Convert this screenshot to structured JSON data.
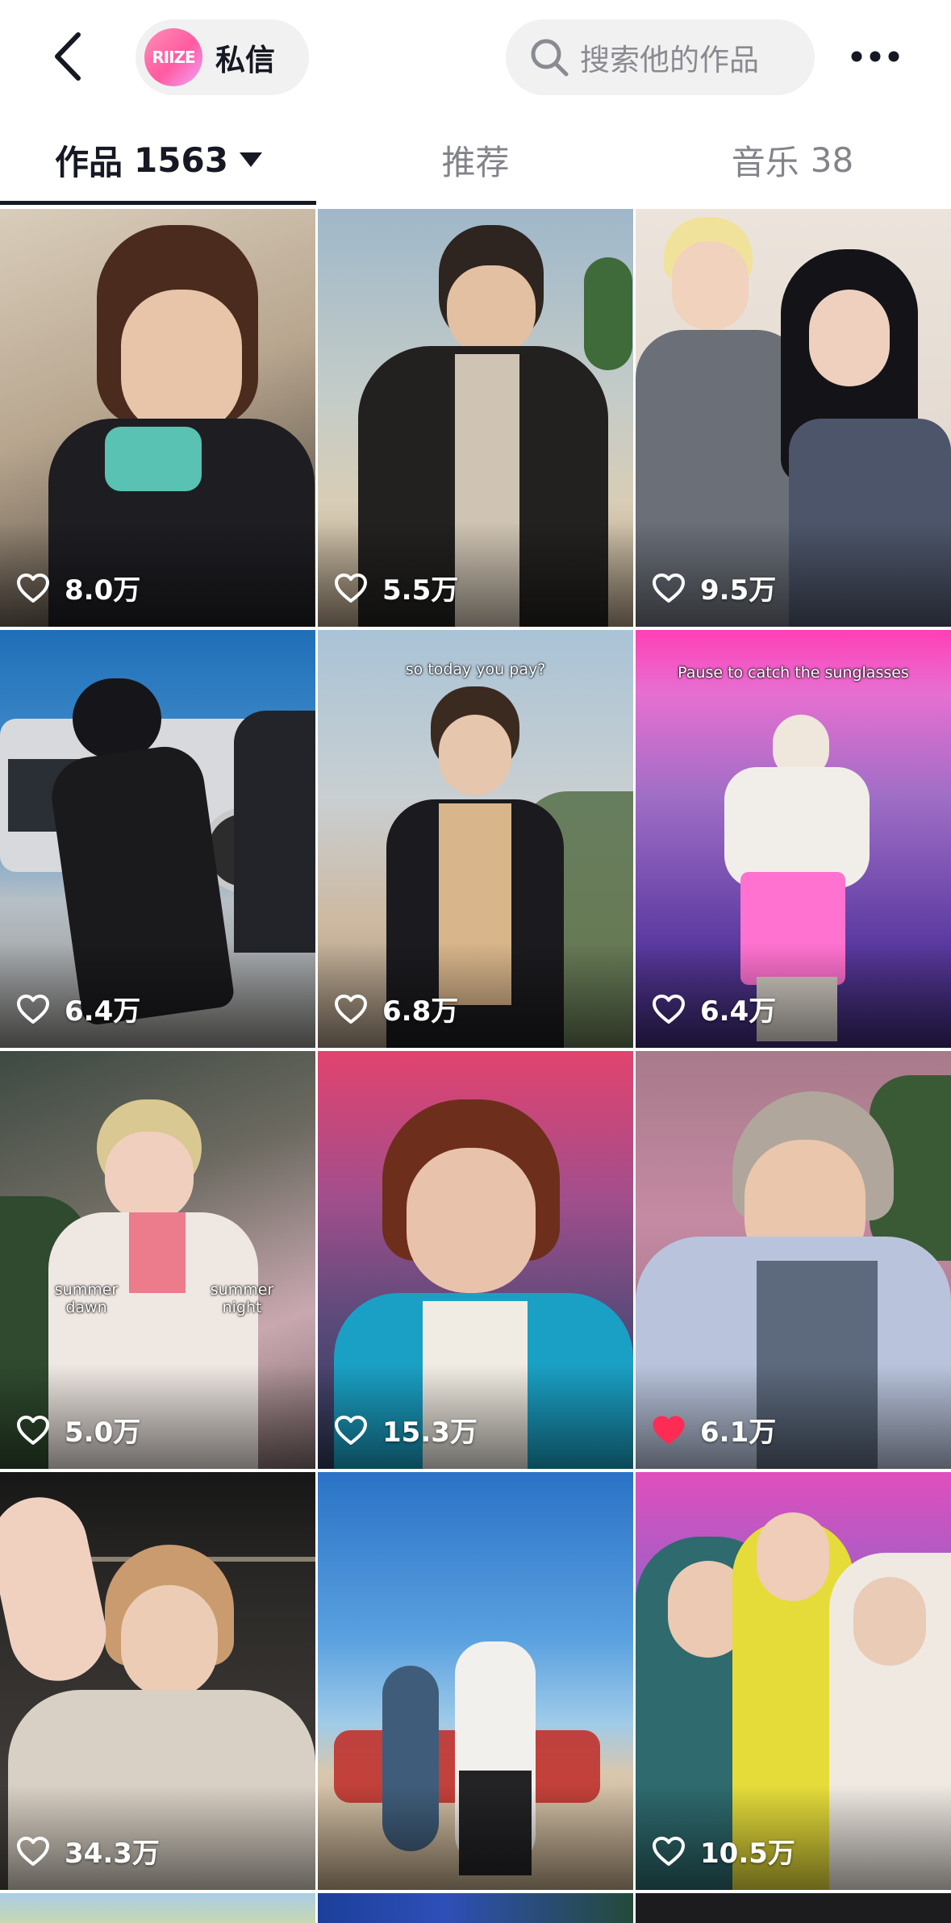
{
  "header": {
    "back_icon": "chevron-left-icon",
    "dm_logo_text": "RIIZE",
    "dm_label": "私信",
    "search_placeholder": "搜索他的作品",
    "more_icon": "ellipsis-icon"
  },
  "tabs": [
    {
      "label": "作品",
      "count": "1563",
      "active": true
    },
    {
      "label": "推荐",
      "count": "",
      "active": false
    },
    {
      "label": "音乐",
      "count": "38",
      "active": false
    }
  ],
  "videos": [
    {
      "likes": "8.0万",
      "liked": false,
      "overlay": ""
    },
    {
      "likes": "5.5万",
      "liked": false,
      "overlay": ""
    },
    {
      "likes": "9.5万",
      "liked": false,
      "overlay": ""
    },
    {
      "likes": "6.4万",
      "liked": false,
      "overlay": ""
    },
    {
      "likes": "6.8万",
      "liked": false,
      "overlay": "so today you pay?"
    },
    {
      "likes": "6.4万",
      "liked": false,
      "overlay": "Pause to catch the sunglasses"
    },
    {
      "likes": "5.0万",
      "liked": false,
      "overlay": "",
      "left_text": "summer dawn",
      "right_text": "summer night"
    },
    {
      "likes": "15.3万",
      "liked": false,
      "overlay": ""
    },
    {
      "likes": "6.1万",
      "liked": true,
      "overlay": ""
    },
    {
      "likes": "34.3万",
      "liked": false,
      "overlay": ""
    },
    {
      "likes": "",
      "liked": false,
      "overlay": ""
    },
    {
      "likes": "10.5万",
      "liked": false,
      "overlay": ""
    }
  ],
  "colors": {
    "like_active": "#fe2c55",
    "tab_active": "#161823",
    "tab_inactive": "#838489",
    "pill_bg": "#f1f1f2"
  }
}
